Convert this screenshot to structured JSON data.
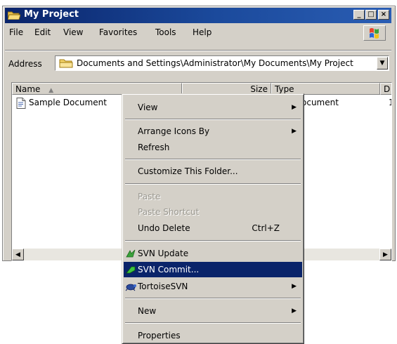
{
  "window": {
    "title": "My Project",
    "controls": [
      "_",
      "□",
      "×"
    ]
  },
  "menubar": {
    "items": [
      "File",
      "Edit",
      "View",
      "Favorites",
      "Tools",
      "Help"
    ]
  },
  "address": {
    "label": "Address",
    "path": "Documents and Settings\\Administrator\\My Documents\\My Project"
  },
  "list": {
    "columns": [
      "Name",
      "Size",
      "Type",
      "D"
    ],
    "rows": [
      {
        "name": "Sample Document",
        "type_partial": "ocument",
        "date_partial": "1"
      }
    ]
  },
  "context_menu": {
    "items": [
      {
        "label": "View",
        "submenu": true
      },
      {
        "label": "Arrange Icons By",
        "submenu": true
      },
      {
        "label": "Refresh"
      },
      {
        "label": "Customize This Folder..."
      },
      {
        "label": "Paste",
        "disabled": true
      },
      {
        "label": "Paste Shortcut",
        "disabled": true
      },
      {
        "label": "Undo Delete",
        "shortcut": "Ctrl+Z"
      },
      {
        "label": "SVN Update",
        "icon": "svn-update-icon"
      },
      {
        "label": "SVN Commit...",
        "icon": "svn-commit-icon",
        "highlighted": true
      },
      {
        "label": "TortoiseSVN",
        "icon": "tortoisesvn-icon",
        "submenu": true
      },
      {
        "label": "New",
        "submenu": true
      },
      {
        "label": "Properties"
      }
    ]
  },
  "colors": {
    "title_bar": "#0a246a",
    "highlight": "#0a246a",
    "face": "#d4d0c8"
  }
}
